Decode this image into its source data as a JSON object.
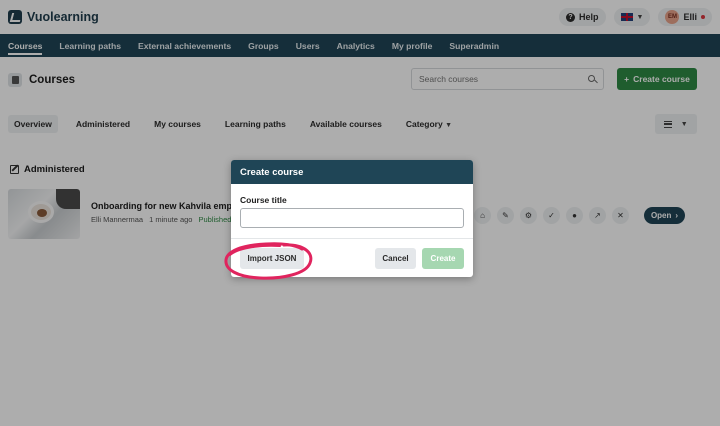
{
  "app": {
    "name": "Vuolearning"
  },
  "header": {
    "help_label": "Help",
    "user_initials": "EM",
    "user_name": "Elli"
  },
  "nav": {
    "items": [
      "Courses",
      "Learning paths",
      "External achievements",
      "Groups",
      "Users",
      "Analytics",
      "My profile",
      "Superadmin"
    ],
    "active": "Courses"
  },
  "page": {
    "title": "Courses",
    "search_placeholder": "Search courses",
    "create_button": "Create course"
  },
  "tabs": {
    "items": [
      "Overview",
      "Administered",
      "My courses",
      "Learning paths",
      "Available courses"
    ],
    "category": "Category",
    "active": "Overview"
  },
  "section": {
    "title": "Administered"
  },
  "course": {
    "title": "Onboarding for new Kahvila emp",
    "author": "Elli Mannermaa",
    "time": "1 minute ago",
    "status": "Published",
    "open_label": "Open"
  },
  "modal": {
    "title": "Create course",
    "field_label": "Course title",
    "field_value": "",
    "import_label": "Import JSON",
    "cancel_label": "Cancel",
    "create_label": "Create"
  },
  "colors": {
    "nav_bg": "#1f4556",
    "primary_green": "#2f8a44",
    "create_disabled": "#a6d7b1",
    "annotation": "#e0245e"
  },
  "icons": {
    "course_actions": [
      "home-icon",
      "pencil-icon",
      "gear-icon",
      "check-circle-icon",
      "user-icon",
      "chart-icon",
      "tools-icon"
    ]
  }
}
